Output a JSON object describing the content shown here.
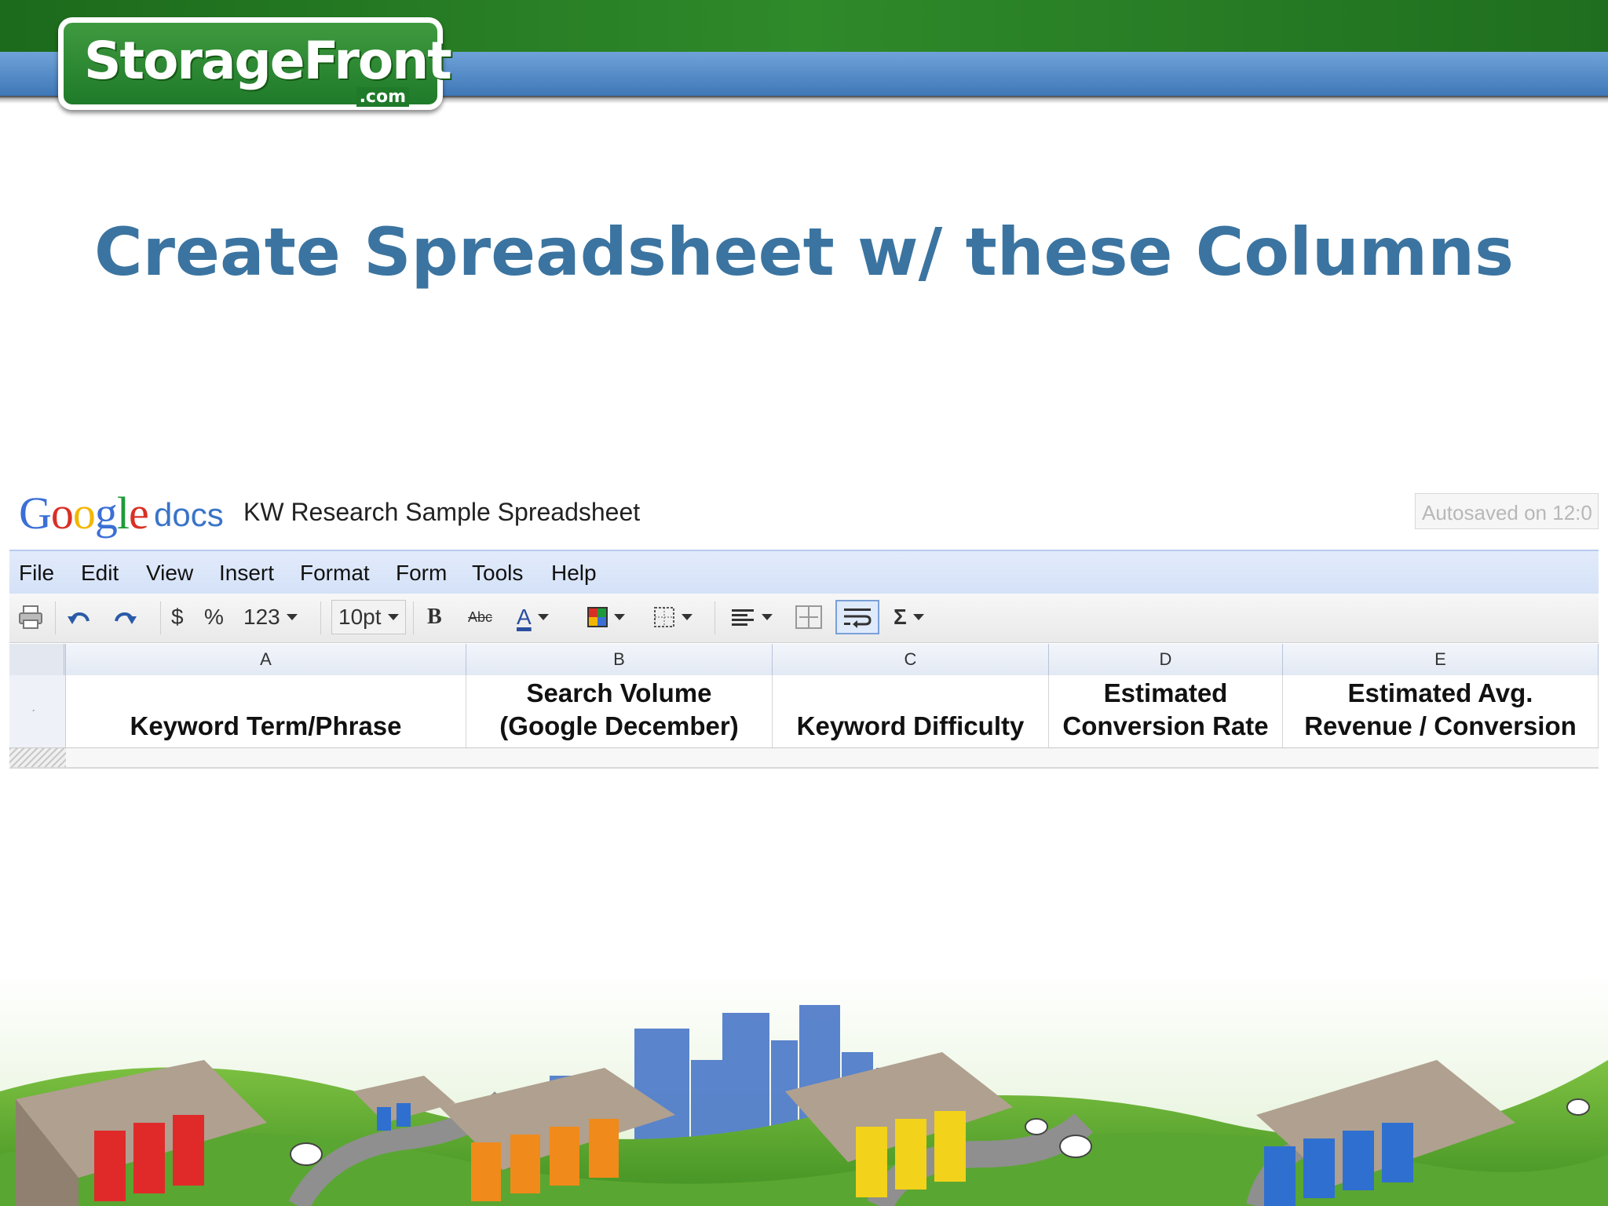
{
  "banner": {
    "logo_brand": "StorageFront",
    "logo_suffix": ".com"
  },
  "slide": {
    "title": "Create Spreadsheet w/ these Columns"
  },
  "gdocs": {
    "brand_letters": [
      {
        "ch": "G",
        "color": "#3b6fd6"
      },
      {
        "ch": "o",
        "color": "#d93025"
      },
      {
        "ch": "o",
        "color": "#f2b600"
      },
      {
        "ch": "g",
        "color": "#3b6fd6"
      },
      {
        "ch": "l",
        "color": "#1f9a3a"
      },
      {
        "ch": "e",
        "color": "#d93025"
      }
    ],
    "product": "docs",
    "doc_title": "KW Research Sample Spreadsheet",
    "autosave": "Autosaved on 12:0",
    "menu": [
      "File",
      "Edit",
      "View",
      "Insert",
      "Format",
      "Form",
      "Tools",
      "Help"
    ],
    "toolbar": {
      "print_icon": "printer-icon",
      "undo_icon": "undo-icon",
      "redo_icon": "redo-icon",
      "currency": "$",
      "percent": "%",
      "number_format": "123",
      "font_size": "10pt",
      "bold": "B",
      "strike": "Abc",
      "text_color": "A",
      "sum": "Σ"
    },
    "columns": [
      "A",
      "B",
      "C",
      "D",
      "E"
    ],
    "header_row": [
      "Keyword Term/Phrase",
      "Search Volume\n(Google December)",
      "Keyword Difficulty",
      "Estimated\nConversion Rate",
      "Estimated Avg.\nRevenue / Conversion"
    ],
    "row_number_1": "ˏ"
  },
  "colors": {
    "title": "#3b74a0",
    "banner_green": "#2f8a2a",
    "banner_blue": "#4f86c6"
  }
}
